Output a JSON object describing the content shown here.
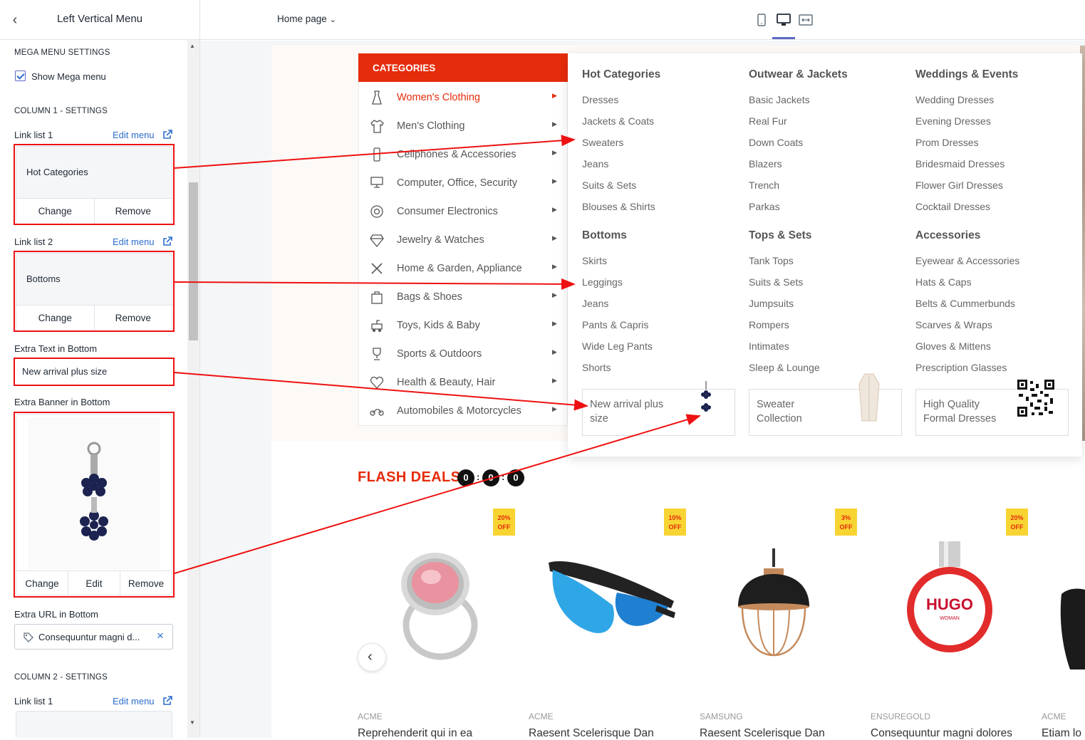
{
  "panel": {
    "title": "Left Vertical Menu",
    "mega_section": "MEGA MENU SETTINGS",
    "show_mega_label": "Show Mega menu",
    "show_mega_checked": true,
    "col1_section": "COLUMN 1 - SETTINGS",
    "link_list_1_label": "Link list 1",
    "link_list_1_value": "Hot Categories",
    "link_list_2_label": "Link list 2",
    "link_list_2_value": "Bottoms",
    "edit_menu": "Edit menu",
    "change": "Change",
    "remove": "Remove",
    "edit": "Edit",
    "extra_text_label": "Extra Text in Bottom",
    "extra_text_value": "New arrival plus size",
    "extra_banner_label": "Extra Banner in Bottom",
    "extra_url_label": "Extra URL in Bottom",
    "extra_url_value": "Consequuntur magni d...",
    "col2_section": "COLUMN 2 - SETTINGS",
    "col2_link_list_1_label": "Link list 1"
  },
  "topbar": {
    "page_select": "Home page",
    "devices": [
      "mobile-icon",
      "desktop-icon",
      "fullwidth-icon"
    ],
    "active_device": "desktop"
  },
  "categories": {
    "header": "CATEGORIES",
    "items": [
      {
        "label": "Women's Clothing",
        "icon": "dress-icon",
        "active": true
      },
      {
        "label": "Men's Clothing",
        "icon": "shirt-icon"
      },
      {
        "label": "Cellphones & Accessories",
        "icon": "phone-icon"
      },
      {
        "label": "Computer, Office, Security",
        "icon": "computer-icon"
      },
      {
        "label": "Consumer Electronics",
        "icon": "camera-icon"
      },
      {
        "label": "Jewelry & Watches",
        "icon": "diamond-icon"
      },
      {
        "label": "Home & Garden, Appliance",
        "icon": "tools-icon"
      },
      {
        "label": "Bags & Shoes",
        "icon": "bag-icon"
      },
      {
        "label": "Toys, Kids & Baby",
        "icon": "toy-icon"
      },
      {
        "label": "Sports & Outdoors",
        "icon": "trophy-icon"
      },
      {
        "label": "Health & Beauty, Hair",
        "icon": "heart-icon"
      },
      {
        "label": "Automobiles & Motorcycles",
        "icon": "motorcycle-icon"
      }
    ]
  },
  "mega": {
    "columns": [
      {
        "groups": [
          {
            "title": "Hot Categories",
            "links": [
              "Dresses",
              "Jackets & Coats",
              "Sweaters",
              "Jeans",
              "Suits & Sets",
              "Blouses & Shirts"
            ]
          },
          {
            "title": "Bottoms",
            "links": [
              "Skirts",
              "Leggings",
              "Jeans",
              "Pants & Capris",
              "Wide Leg Pants",
              "Shorts"
            ]
          }
        ],
        "banner": [
          "New arrival plus",
          "size"
        ]
      },
      {
        "groups": [
          {
            "title": "Outwear & Jackets",
            "links": [
              "Basic Jackets",
              "Real Fur",
              "Down Coats",
              "Blazers",
              "Trench",
              "Parkas"
            ]
          },
          {
            "title": "Tops & Sets",
            "links": [
              "Tank Tops",
              "Suits & Sets",
              "Jumpsuits",
              "Rompers",
              "Intimates",
              "Sleep & Lounge"
            ]
          }
        ],
        "banner": [
          "Sweater",
          "Collection"
        ]
      },
      {
        "groups": [
          {
            "title": "Weddings & Events",
            "links": [
              "Wedding Dresses",
              "Evening Dresses",
              "Prom Dresses",
              "Bridesmaid Dresses",
              "Flower Girl Dresses",
              "Cocktail Dresses"
            ]
          },
          {
            "title": "Accessories",
            "links": [
              "Eyewear & Accessories",
              "Hats & Caps",
              "Belts & Cummerbunds",
              "Scarves & Wraps",
              "Gloves & Mittens",
              "Prescription Glasses"
            ]
          }
        ],
        "banner": [
          "High Quality",
          "Formal Dresses"
        ]
      }
    ]
  },
  "flash": {
    "title": "FLASH DEALS",
    "timer": [
      "0",
      "0",
      "0"
    ],
    "products": [
      {
        "badge": [
          "20%",
          "OFF"
        ],
        "brand": "ACME",
        "title": "Reprehenderit qui in ea"
      },
      {
        "badge": [
          "10%",
          "OFF"
        ],
        "brand": "ACME",
        "title": "Raesent Scelerisque Dan"
      },
      {
        "badge": [
          "3%",
          "OFF"
        ],
        "brand": "SAMSUNG",
        "title": "Raesent Scelerisque Dan"
      },
      {
        "badge": [
          "20%",
          "OFF"
        ],
        "brand": "ENSUREGOLD",
        "title": "Consequuntur magni dolores"
      },
      {
        "brand": "ACME",
        "title": "Etiam lo"
      }
    ]
  },
  "colors": {
    "accent": "#e52c0b",
    "link": "#2c6ecb",
    "annotation": "#ee1111",
    "badge": "#f8d433"
  }
}
